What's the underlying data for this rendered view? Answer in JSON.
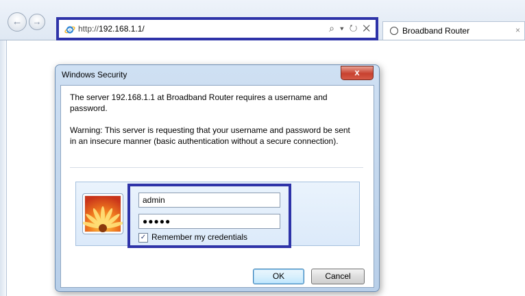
{
  "browser": {
    "address": {
      "prefix": "http://",
      "host": "192.168.1.1/",
      "tools": "⌕ ▾ ↻ ✕"
    },
    "tab": {
      "title": "Broadband Router",
      "close": "×"
    }
  },
  "dialog": {
    "title": "Windows Security",
    "close_glyph": "x",
    "message": "The server 192.168.1.1 at Broadband Router requires a username and password.",
    "warning": "Warning: This server is requesting that your username and password be sent in an insecure manner (basic authentication without a secure connection).",
    "username_value": "admin",
    "password_value": "●●●●●",
    "remember_checked": true,
    "remember_label": "Remember my credentials",
    "ok_label": "OK",
    "cancel_label": "Cancel"
  },
  "colors": {
    "highlight_border": "#2e33a8",
    "close_button": "#c7412f"
  }
}
